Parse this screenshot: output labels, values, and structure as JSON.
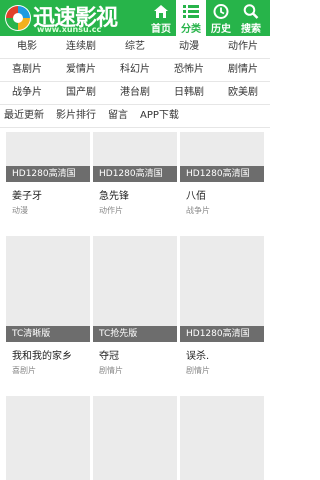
{
  "header": {
    "logo_text": "迅速影视",
    "logo_url": "www.xunsu.cc",
    "nav": [
      {
        "label": "首页",
        "icon": "home-icon",
        "active": false
      },
      {
        "label": "分类",
        "icon": "list-icon",
        "active": true
      },
      {
        "label": "历史",
        "icon": "clock-icon",
        "active": false
      },
      {
        "label": "搜索",
        "icon": "search-icon",
        "active": false
      }
    ]
  },
  "categories": {
    "row1": [
      "电影",
      "连续剧",
      "综艺",
      "动漫",
      "动作片"
    ],
    "row2": [
      "喜剧片",
      "爱情片",
      "科幻片",
      "恐怖片",
      "剧情片"
    ],
    "row3": [
      "战争片",
      "国产剧",
      "港台剧",
      "日韩剧",
      "欧美剧"
    ],
    "row4": [
      "最近更新",
      "影片排行",
      "留言",
      "APP下载"
    ]
  },
  "movies": [
    {
      "tag": "HD1280高清国",
      "title": "姜子牙",
      "genre": "动漫"
    },
    {
      "tag": "HD1280高清国",
      "title": "急先锋",
      "genre": "动作片"
    },
    {
      "tag": "HD1280高清国",
      "title": "八佰",
      "genre": "战争片"
    },
    {
      "tag": "TC清晰版",
      "title": "我和我的家乡",
      "genre": "喜剧片"
    },
    {
      "tag": "TC抢先版",
      "title": "夺冠",
      "genre": "剧情片"
    },
    {
      "tag": "HD1280高清国",
      "title": "误杀.",
      "genre": "剧情片"
    }
  ],
  "colors": {
    "brand": "#27b44a",
    "tag_bg": "#6d6d6d",
    "placeholder": "#ebebeb"
  }
}
